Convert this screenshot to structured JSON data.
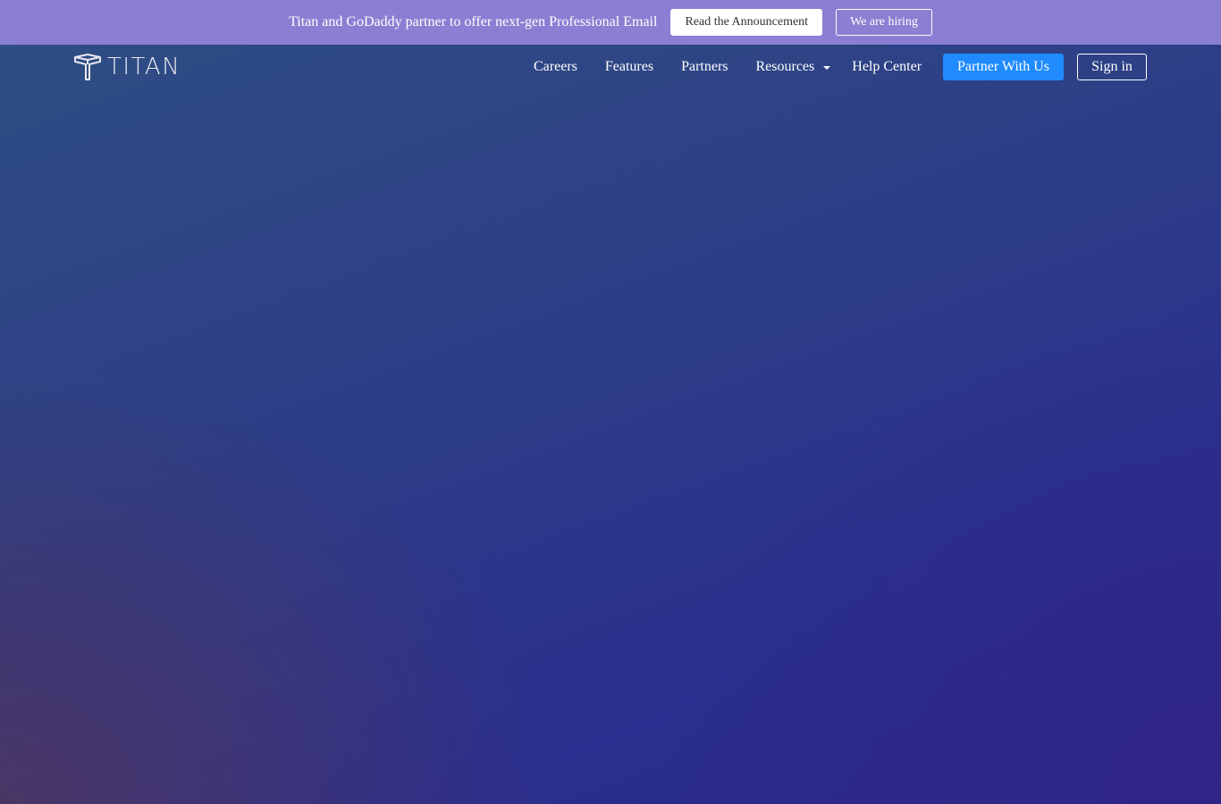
{
  "announcement": {
    "text": "Titan and GoDaddy partner to offer next-gen Professional Email",
    "read_button": "Read the Announcement",
    "hiring_button": "We are hiring"
  },
  "header": {
    "logo_text": "TITAN",
    "logo_icon": "titan-cube-icon",
    "nav": {
      "careers": "Careers",
      "features": "Features",
      "partners": "Partners",
      "resources": "Resources",
      "help_center": "Help Center"
    },
    "partner_button": "Partner With Us",
    "signin_button": "Sign in"
  },
  "colors": {
    "announcement_bar": "#8a7fd2",
    "primary_button": "#1f8bff",
    "hero_gradient_start": "#2f4f84",
    "hero_gradient_end": "#2b2888"
  }
}
